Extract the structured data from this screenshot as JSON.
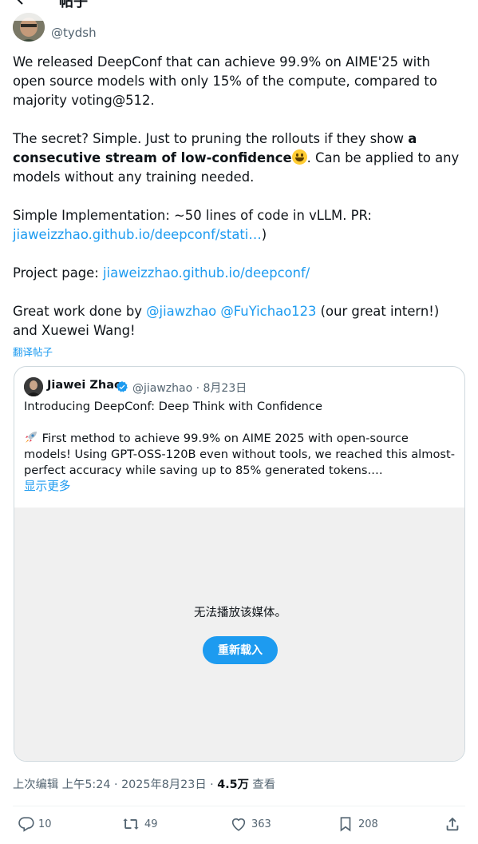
{
  "header": {
    "title": "帖子"
  },
  "author": {
    "handle": "@tydsh"
  },
  "tweet": {
    "p1": "We released DeepConf that can achieve 99.9% on AIME'25 with open source models with only 15% of the compute, compared to majority voting@512.",
    "p2_before": "The secret? Simple. Just to pruning the rollouts if they show ",
    "p2_bold": "a consecutive stream of low-confidence",
    "p2_after": ". Can be applied to any models without any training needed.",
    "p3_text": "Simple Implementation: ~50 lines of code in vLLM. PR:",
    "p3_link": "jiaweizzhao.github.io/deepconf/stati…",
    "p3_close": ")",
    "p4_label": "Project page: ",
    "p4_link": "jiaweizzhao.github.io/deepconf/",
    "p5_before": "Great work done by ",
    "p5_mention1": "@jiawzhao",
    "p5_space": " ",
    "p5_mention2": "@FuYichao123",
    "p5_after": " (our great intern!) and Xuewei Wang!"
  },
  "translate": "翻译帖子",
  "quote": {
    "name": "Jiawei Zhao",
    "meta": "@jiawzhao · 8月23日",
    "title": "Introducing DeepConf: Deep Think with Confidence",
    "body": " First method to achieve 99.9% on AIME 2025 with open-source models! Using GPT-OSS-120B even without tools, we reached this almost-perfect accuracy while saving up to 85% generated tokens.…",
    "show_more": "显示更多",
    "media_message": "无法播放该媒体。",
    "reload_label": "重新载入"
  },
  "meta": {
    "edited": "上次编辑 上午5:24 · 2025年8月23日 · ",
    "views_count": "4.5万",
    "views_label": " 查看"
  },
  "actions": {
    "replies": "10",
    "reposts": "49",
    "likes": "363",
    "bookmarks": "208"
  },
  "colors": {
    "accent": "#1d9bf0",
    "text": "#0f1419",
    "secondary": "#536471"
  },
  "icons": [
    "back-arrow-icon",
    "verified-badge-icon",
    "rocket-icon",
    "reply-icon",
    "repost-icon",
    "like-icon",
    "bookmark-icon",
    "share-icon"
  ]
}
